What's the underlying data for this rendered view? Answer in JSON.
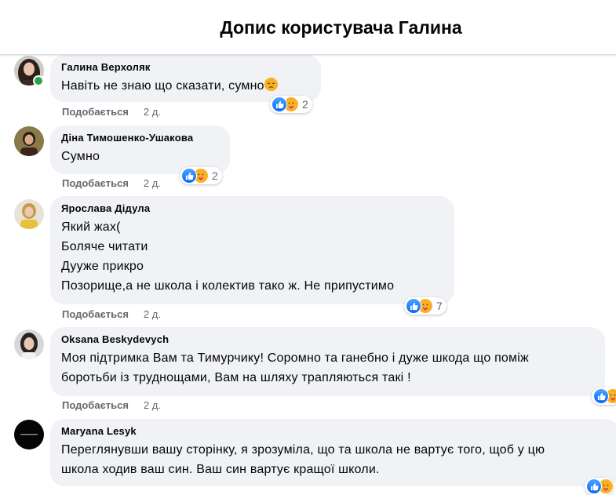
{
  "header": {
    "title": "Допис користувача Галина"
  },
  "actions": {
    "like_label": "Подобається"
  },
  "comments": [
    {
      "author": "Галина Верхоляк",
      "lines": [
        "Навіть не знаю що сказати, сумно"
      ],
      "trailing_emoji": "pensive-face",
      "time": "2 д.",
      "reaction_count": "2",
      "online": true
    },
    {
      "author": "Діна Тимошенко-Ушакова",
      "lines": [
        "Сумно"
      ],
      "time": "2 д.",
      "reaction_count": "2"
    },
    {
      "author": "Ярослава Дідула",
      "lines": [
        "Який жах(",
        "Боляче читати",
        "Дууже прикро",
        "Позорище,а не школа і колектив тако ж. Не припустимо"
      ],
      "time": "2 д.",
      "reaction_count": "7"
    },
    {
      "author": "Oksana Beskydevych",
      "lines": [
        "Моя підтримка Вам та Тимурчику! Соромно та ганебно і дуже шкода що поміж",
        "боротьби із труднощами, Вам на шляху трапляються такі !"
      ],
      "time": "2 д."
    },
    {
      "author": "Maryana Lesyk",
      "lines": [
        "Переглянувши вашу сторінку, я зрозуміла, що та школа не вартує того, щоб у цю",
        "школа ходив ваш син. Ваш син вартує кращої школи."
      ]
    }
  ],
  "colors": {
    "bubble": "#f0f2f5",
    "like_blue": "#0866ff",
    "care_yellow": "#f7b125",
    "meta_gray": "#65676b",
    "online_green": "#31a24c"
  }
}
